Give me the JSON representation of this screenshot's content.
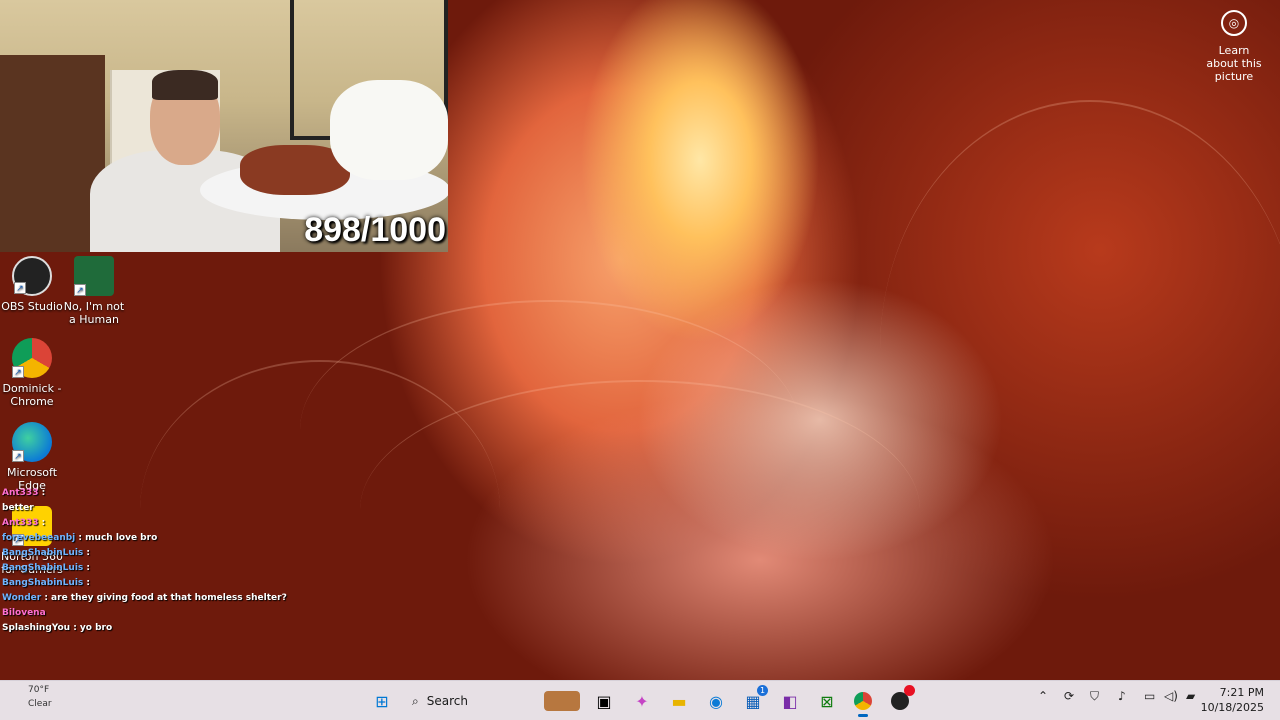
{
  "webcam": {
    "counter": "898/1000"
  },
  "learn": {
    "label": "Learn about this picture",
    "icon": "camera-icon"
  },
  "desktop_icons": [
    {
      "label": "OBS Studio",
      "icon": "obs-icon"
    },
    {
      "label": "No, I'm not a Human",
      "icon": "game-icon"
    },
    {
      "label": "Dominick - Chrome",
      "icon": "chrome-icon"
    },
    {
      "label": "Microsoft Edge",
      "icon": "edge-icon"
    },
    {
      "label": "Norton 360 for Gamers",
      "icon": "norton-icon"
    }
  ],
  "chat": [
    {
      "user": "Ant333",
      "msg": ":"
    },
    {
      "user": "",
      "msg": "better"
    },
    {
      "user": "Ant333",
      "msg": ":"
    },
    {
      "user": "forevebeeanbj",
      "msg": ": much love bro"
    },
    {
      "user": "BangShabinLuis",
      "msg": ":"
    },
    {
      "user": "BangShabinLuis",
      "msg": ":"
    },
    {
      "user": "BangShabinLuis",
      "msg": ":"
    },
    {
      "user": "Wonder",
      "msg": ": are they giving food at that homeless shelter?"
    },
    {
      "user": "Bilovena",
      "msg": ""
    },
    {
      "user": "SplashingYou",
      "msg": ": yo bro"
    }
  ],
  "taskbar": {
    "weather_temp": "70°F",
    "weather_desc": "Clear",
    "search_placeholder": "Search",
    "time": "7:21 PM",
    "date": "10/18/2025",
    "store_badge": "1"
  },
  "colors": {
    "taskbar_bg": "#ece8ee",
    "accent": "#0067c0"
  }
}
